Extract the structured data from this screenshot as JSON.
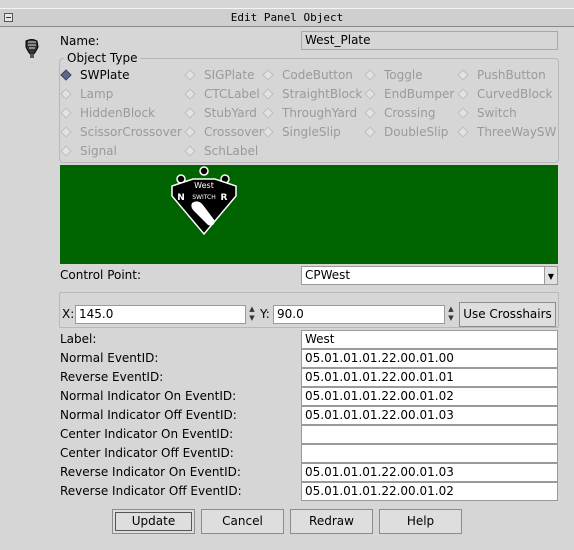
{
  "window": {
    "title": "Edit Panel Object"
  },
  "name": {
    "label": "Name:",
    "value": "West_Plate"
  },
  "object_type": {
    "legend": "Object Type",
    "options": [
      [
        "SWPlate",
        "SIGPlate",
        "CodeButton",
        "Toggle",
        "PushButton"
      ],
      [
        "Lamp",
        "CTCLabel",
        "StraightBlock",
        "EndBumper",
        "CurvedBlock"
      ],
      [
        "HiddenBlock",
        "StubYard",
        "ThroughYard",
        "Crossing",
        "Switch"
      ],
      [
        "ScissorCrossover",
        "Crossover",
        "SingleSlip",
        "DoubleSlip",
        "ThreeWaySW"
      ],
      [
        "Signal",
        "SchLabel"
      ]
    ],
    "selected": "SWPlate"
  },
  "preview": {
    "plate_title": "West",
    "plate_middle": "SWITCH",
    "plate_left": "N",
    "plate_right": "R",
    "colors": {
      "background": "#006400",
      "plate": "#000000",
      "outline": "#ffffff"
    }
  },
  "control_point": {
    "label": "Control Point:",
    "value": "CPWest"
  },
  "coords": {
    "x_label": "X:",
    "x_value": "145.0",
    "y_label": "Y:",
    "y_value": "90.0",
    "crosshairs_label": "Use Crosshairs"
  },
  "fields": [
    {
      "label": "Label:",
      "value": "West"
    },
    {
      "label": "Normal EventID:",
      "value": "05.01.01.01.22.00.01.00"
    },
    {
      "label": "Reverse EventID:",
      "value": "05.01.01.01.22.00.01.01"
    },
    {
      "label": "Normal Indicator On EventID:",
      "value": "05.01.01.01.22.00.01.02"
    },
    {
      "label": "Normal Indicator Off EventID:",
      "value": "05.01.01.01.22.00.01.03"
    },
    {
      "label": "Center Indicator On EventID:",
      "value": ""
    },
    {
      "label": "Center Indicator Off EventID:",
      "value": ""
    },
    {
      "label": "Reverse Indicator On EventID:",
      "value": "05.01.01.01.22.00.01.03"
    },
    {
      "label": "Reverse Indicator Off EventID:",
      "value": "05.01.01.01.22.00.01.02"
    }
  ],
  "buttons": {
    "update": "Update",
    "cancel": "Cancel",
    "redraw": "Redraw",
    "help": "Help"
  }
}
